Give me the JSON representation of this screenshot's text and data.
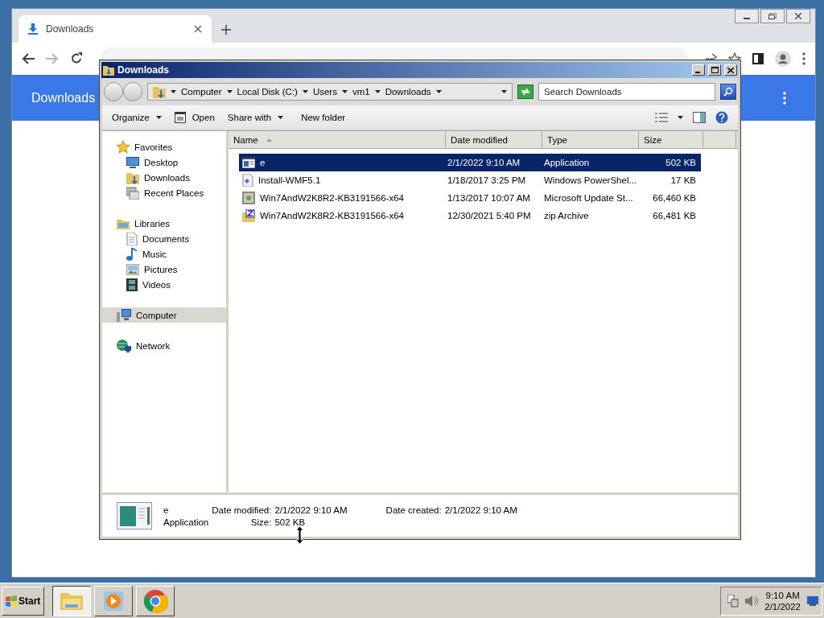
{
  "chrome": {
    "tab": {
      "title": "Downloads",
      "selected": true
    },
    "page_title": "Downloads"
  },
  "explorer": {
    "title": "Downloads",
    "breadcrumb": [
      "Computer",
      "Local Disk (C:)",
      "Users",
      "vm1",
      "Downloads"
    ],
    "search": {
      "placeholder": "Search Downloads"
    },
    "toolbar": [
      {
        "label": "Organize",
        "kind": "menu"
      },
      {
        "label": "Open",
        "kind": "icon"
      },
      {
        "label": "Share with",
        "kind": "menu"
      },
      {
        "label": "New folder",
        "kind": "plain"
      }
    ],
    "nav": [
      {
        "label": "Favorites",
        "kind": "star",
        "selected": false,
        "children": [
          {
            "label": "Desktop",
            "kind": "desktop",
            "selected": false
          },
          {
            "label": "Downloads",
            "kind": "folder",
            "selected": false
          },
          {
            "label": "Recent Places",
            "kind": "recent",
            "selected": false
          }
        ]
      },
      {
        "label": "Libraries",
        "kind": "library",
        "selected": false,
        "children": [
          {
            "label": "Documents",
            "kind": "document",
            "selected": false
          },
          {
            "label": "Music",
            "kind": "music",
            "selected": false
          },
          {
            "label": "Pictures",
            "kind": "pictures",
            "selected": false
          },
          {
            "label": "Videos",
            "kind": "videos",
            "selected": false
          }
        ]
      },
      {
        "label": "Computer",
        "kind": "computer",
        "selected": true
      },
      {
        "label": "Network",
        "kind": "network",
        "selected": false
      }
    ],
    "columns": [
      {
        "label": "Name",
        "sorted": true
      },
      {
        "label": "Date modified",
        "sorted": false
      },
      {
        "label": "Type",
        "sorted": false
      },
      {
        "label": "Size",
        "sorted": false
      }
    ],
    "files": [
      {
        "name": "e",
        "date": "2/1/2022 9:10 AM",
        "type": "Application",
        "size": "502 KB",
        "kind": "app",
        "selected": true
      },
      {
        "name": "Install-WMF5.1",
        "date": "1/18/2017 3:25 PM",
        "type": "Windows PowerShel...",
        "size": "17 KB",
        "kind": "script",
        "selected": false
      },
      {
        "name": "Win7AndW2K8R2-KB3191566-x64",
        "date": "1/13/2017 10:07 AM",
        "type": "Microsoft Update St...",
        "size": "66,460 KB",
        "kind": "update",
        "selected": false
      },
      {
        "name": "Win7AndW2K8R2-KB3191566-x64",
        "date": "12/30/2021 5:40 PM",
        "type": "zip Archive",
        "size": "66,481 KB",
        "kind": "zip",
        "selected": false
      }
    ],
    "details": {
      "name": "e",
      "type": "Application",
      "fields": [
        {
          "label": "Date modified:",
          "value": "2/1/2022 9:10 AM"
        },
        {
          "label": "Size:",
          "value": "502 KB"
        },
        {
          "label": "Date created:",
          "value": "2/1/2022 9:10 AM"
        }
      ]
    }
  },
  "taskbar": {
    "start": "Start",
    "apps": [
      {
        "kind": "explorer",
        "selected": true
      },
      {
        "kind": "media",
        "selected": false
      },
      {
        "kind": "chrome",
        "selected": false
      }
    ],
    "clock": {
      "time": "9:10 AM",
      "date": "2/1/2022"
    }
  }
}
